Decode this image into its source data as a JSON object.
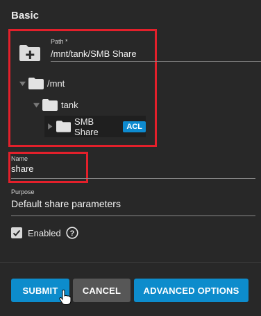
{
  "section": {
    "title": "Basic"
  },
  "path": {
    "label": "Path *",
    "value": "/mnt/tank/SMB Share",
    "tree": {
      "root": "/mnt",
      "child": "tank",
      "leaf": "SMB Share",
      "leaf_badge": "ACL"
    }
  },
  "name": {
    "label": "Name",
    "value": "share"
  },
  "purpose": {
    "label": "Purpose",
    "value": "Default share parameters"
  },
  "enabled": {
    "label": "Enabled",
    "checked": true
  },
  "buttons": {
    "submit": "SUBMIT",
    "cancel": "CANCEL",
    "advanced": "ADVANCED OPTIONS"
  },
  "colors": {
    "accent": "#0d8ccc",
    "highlight": "#e3202b",
    "background": "#282828"
  },
  "icons": [
    "folder-add-icon",
    "folder-icon",
    "caret-down-icon",
    "caret-right-icon",
    "check-icon",
    "help-icon",
    "hand-cursor-icon"
  ]
}
